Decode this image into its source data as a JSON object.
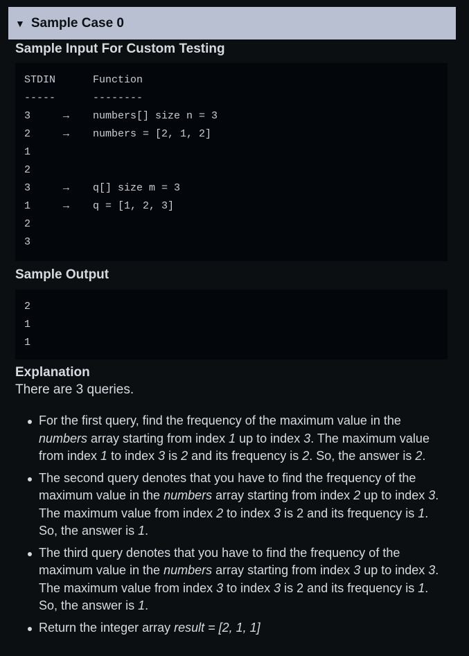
{
  "case": {
    "caret": "▼",
    "title": "Sample Case 0"
  },
  "sample_input": {
    "title": "Sample Input For Custom Testing",
    "lines": [
      {
        "stdin": "STDIN",
        "arrow": "",
        "func": "Function"
      },
      {
        "stdin": "-----",
        "arrow": "",
        "func": "--------"
      },
      {
        "stdin": "3",
        "arrow": "→",
        "func": "numbers[] size n = 3"
      },
      {
        "stdin": "2",
        "arrow": "→",
        "func": "numbers = [2, 1, 2]"
      },
      {
        "stdin": "1",
        "arrow": "",
        "func": ""
      },
      {
        "stdin": "2",
        "arrow": "",
        "func": ""
      },
      {
        "stdin": "3",
        "arrow": "→",
        "func": "q[] size m = 3"
      },
      {
        "stdin": "1",
        "arrow": "→",
        "func": "q = [1, 2, 3]"
      },
      {
        "stdin": "2",
        "arrow": "",
        "func": ""
      },
      {
        "stdin": "3",
        "arrow": "",
        "func": ""
      }
    ]
  },
  "sample_output": {
    "title": "Sample Output",
    "lines": [
      "2",
      "1",
      "1"
    ]
  },
  "explanation": {
    "title": "Explanation",
    "intro": "There are 3 queries.",
    "bullets": [
      [
        {
          "t": "For the first query, find the frequency of the maximum value in the "
        },
        {
          "t": "numbers",
          "i": true
        },
        {
          "t": " array starting from index "
        },
        {
          "t": "1",
          "i": true
        },
        {
          "t": " up to index "
        },
        {
          "t": "3",
          "i": true
        },
        {
          "t": ". The maximum value from index "
        },
        {
          "t": "1",
          "i": true
        },
        {
          "t": " to index "
        },
        {
          "t": "3",
          "i": true
        },
        {
          "t": " is "
        },
        {
          "t": "2",
          "i": true
        },
        {
          "t": " and its frequency is "
        },
        {
          "t": "2",
          "i": true
        },
        {
          "t": ". So, the answer is "
        },
        {
          "t": "2",
          "i": true
        },
        {
          "t": "."
        }
      ],
      [
        {
          "t": "The second query denotes that you have to find the frequency of the maximum value in the "
        },
        {
          "t": "numbers",
          "i": true
        },
        {
          "t": " array starting from index "
        },
        {
          "t": "2",
          "i": true
        },
        {
          "t": " up to index "
        },
        {
          "t": "3",
          "i": true
        },
        {
          "t": ". The maximum value from index "
        },
        {
          "t": "2",
          "i": true
        },
        {
          "t": " to index "
        },
        {
          "t": "3",
          "i": true
        },
        {
          "t": " is 2 and its frequency is "
        },
        {
          "t": "1",
          "i": true
        },
        {
          "t": ". So, the answer is "
        },
        {
          "t": "1",
          "i": true
        },
        {
          "t": "."
        }
      ],
      [
        {
          "t": "The third query denotes that you have to find the frequency of the maximum value in the "
        },
        {
          "t": "numbers",
          "i": true
        },
        {
          "t": " array starting from index "
        },
        {
          "t": "3",
          "i": true
        },
        {
          "t": " up to index "
        },
        {
          "t": "3",
          "i": true
        },
        {
          "t": ". The maximum value from index "
        },
        {
          "t": "3",
          "i": true
        },
        {
          "t": " to index "
        },
        {
          "t": "3",
          "i": true
        },
        {
          "t": " is 2 and its frequency is "
        },
        {
          "t": "1",
          "i": true
        },
        {
          "t": ". So, the answer is "
        },
        {
          "t": "1",
          "i": true
        },
        {
          "t": "."
        }
      ],
      [
        {
          "t": "Return the integer array "
        },
        {
          "t": "result = [2, 1, 1]",
          "i": true
        }
      ]
    ]
  },
  "colors": {
    "page_bg": "#0b0f12",
    "header_bg": "#b9c0d1",
    "code_bg": "#03060a",
    "text": "#d6dbe1"
  }
}
